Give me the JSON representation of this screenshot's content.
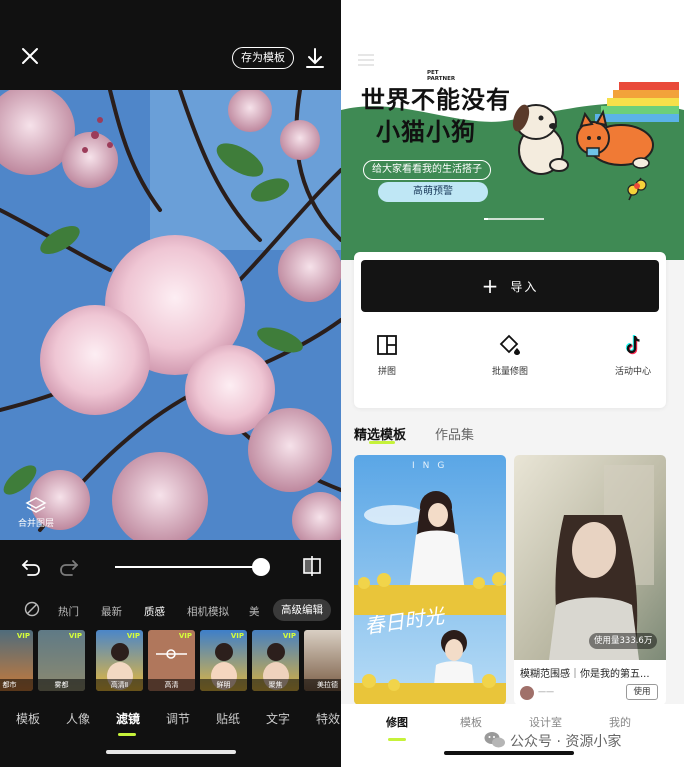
{
  "left": {
    "header": {
      "save_template": "存为模板"
    },
    "merge_layer": "合并图层",
    "filter_categories": [
      "热门",
      "最新",
      "质感",
      "相机模拟",
      "美"
    ],
    "advanced_edit": "高级编辑",
    "thumbnails": [
      {
        "label": "都市",
        "vip": "VIP"
      },
      {
        "label": "雾都",
        "vip": "VIP"
      },
      {
        "label": "高清Ⅱ",
        "vip": "VIP"
      },
      {
        "label": "高清",
        "vip": "VIP"
      },
      {
        "label": "鲜明",
        "vip": "VIP"
      },
      {
        "label": "聚焦",
        "vip": "VIP"
      },
      {
        "label": "美拉德",
        "vip": ""
      }
    ],
    "tools": [
      "模板",
      "人像",
      "滤镜",
      "调节",
      "贴纸",
      "文字",
      "特效"
    ],
    "active_tool": "滤镜",
    "slider_level": 1.0
  },
  "right": {
    "banner": {
      "pet_partner": "PET PARTNER",
      "title_line1": "世界不能没有",
      "title_line2": "小猫小狗",
      "subtitle": "给大家看看我的生活搭子",
      "pill": "高萌预警"
    },
    "import_label": "导入",
    "features": [
      {
        "label": "拼图",
        "icon": "collage-icon"
      },
      {
        "label": "批量修图",
        "icon": "batch-edit-icon"
      },
      {
        "label": "活动中心",
        "icon": "tiktok-icon"
      }
    ],
    "section_tabs": [
      "精选模板",
      "作品集"
    ],
    "template_card1": {
      "overlay_text": "ING",
      "script_text": "春日时光"
    },
    "template_card2": {
      "usage": "使用量333.6万",
      "title": "模糊范围感｜你是我的第五...",
      "author": "一一",
      "use_label": "使用"
    },
    "nav": [
      "修图",
      "模板",
      "设计室",
      "我的"
    ],
    "watermark": "公众号 · 资源小家"
  },
  "colors": {
    "accent_green": "#c6f23a",
    "banner_green": "#3f8a54"
  }
}
